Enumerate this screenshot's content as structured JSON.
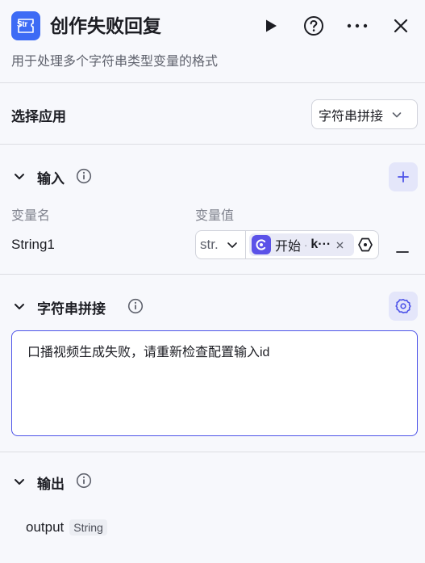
{
  "header": {
    "app_icon_text": "Str",
    "title": "创作失败回复",
    "subtitle": "用于处理多个字符串类型变量的格式"
  },
  "select_app": {
    "label": "选择应用",
    "value": "字符串拼接"
  },
  "input_section": {
    "label": "输入",
    "col_name": "变量名",
    "col_value": "变量值",
    "rows": [
      {
        "name": "String1",
        "type": "str.",
        "ref_source": "开始",
        "ref_sep": "·",
        "ref_var": "k···"
      }
    ]
  },
  "concat_section": {
    "label": "字符串拼接",
    "text": "口播视频生成失败，请重新检查配置输入id"
  },
  "output_section": {
    "label": "输出",
    "outputs": [
      {
        "name": "output",
        "type": "String"
      }
    ]
  },
  "colors": {
    "accent": "#4d53e8",
    "app_icon_bg": "#3d6bf5",
    "chip_icon_bg": "#5b52e8",
    "button_bg": "#e4e6fa"
  }
}
